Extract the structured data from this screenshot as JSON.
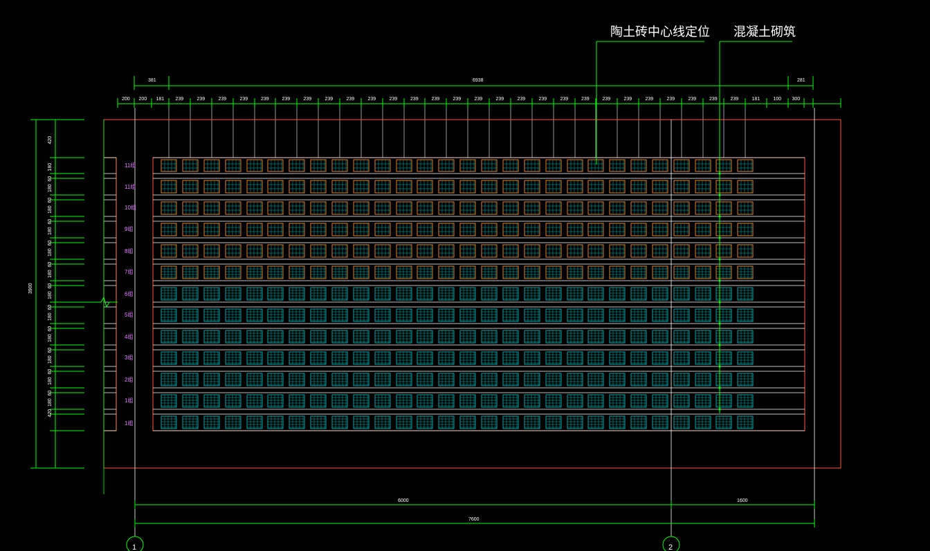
{
  "colors": {
    "background": "#000000",
    "dimension_line": "#00ff00",
    "outline": "#ff5a3c",
    "brick_outline": "#ff8c28",
    "brick_fill_line": "#00b4b4",
    "concrete_line": "#ffffff",
    "row_label": "#e080ff",
    "text": "#ffffff"
  },
  "annotations": {
    "clay_brick_centerline": "陶土砖中心线定位",
    "concrete_masonry": "混凝土砌筑"
  },
  "top_dimensions": {
    "overall": [
      "381",
      "6938",
      "281"
    ],
    "detail": [
      "200",
      "200",
      "181",
      "239",
      "239",
      "239",
      "239",
      "239",
      "239",
      "239",
      "239",
      "239",
      "239",
      "239",
      "239",
      "239",
      "239",
      "239",
      "239",
      "239",
      "239",
      "239",
      "239",
      "239",
      "239",
      "239",
      "239",
      "239",
      "239",
      "239",
      "181",
      "100",
      "300"
    ]
  },
  "left_dimensions": {
    "overall": "3900",
    "detail": [
      "420",
      "180",
      "60",
      "180",
      "60",
      "180",
      "60",
      "180",
      "60",
      "180",
      "60",
      "180",
      "60",
      "180",
      "60",
      "180",
      "60",
      "180",
      "60",
      "180",
      "60",
      "180",
      "60",
      "180",
      "420"
    ]
  },
  "row_labels": [
    "11组",
    "11组",
    "10组",
    "9组",
    "8组",
    "7组",
    "6组",
    "5组",
    "4组",
    "3组",
    "2组",
    "1组",
    "1组"
  ],
  "bottom_dimensions": {
    "segments": [
      "6000",
      "1600"
    ],
    "total": "7600"
  },
  "axis_markers": [
    "1",
    "2"
  ]
}
